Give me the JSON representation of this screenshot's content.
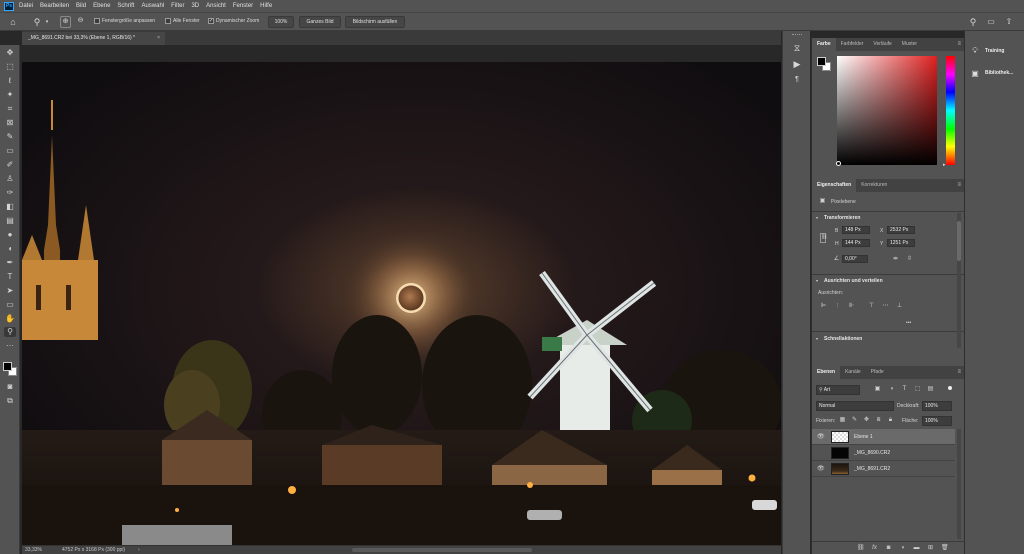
{
  "app": {
    "logo": "Ps"
  },
  "menu": [
    "Datei",
    "Bearbeiten",
    "Bild",
    "Ebene",
    "Schrift",
    "Auswahl",
    "Filter",
    "3D",
    "Ansicht",
    "Fenster",
    "Hilfe"
  ],
  "options": {
    "fit_windows_label": "Fenstergröße anpassen",
    "all_windows_label": "Alle Fenster",
    "scrubby_zoom_label": "Dynamischer Zoom",
    "zoom_percent_label": "100%",
    "fit_screen_label": "Ganzes Bild",
    "fill_screen_label": "Bildschirm ausfüllen",
    "checked": "✓"
  },
  "document": {
    "tab_title": "_MG_8691.CR2 bei 33,3% (Ebene 1, RGB/16) *",
    "close": "×",
    "zoom_status": "33,33%",
    "size_status": "4752 Px x 3168 Px (300 ppi)"
  },
  "color_panel": {
    "tabs": [
      "Farbe",
      "Farbfelder",
      "Verläufe",
      "Muster"
    ],
    "hue_color": "#e02020"
  },
  "properties_panel": {
    "tabs": [
      "Eigenschaften",
      "Korrekturen"
    ],
    "layer_type": "Pixelebene",
    "transform_title": "Transformieren",
    "w_label": "B",
    "w_value": "148 Px",
    "h_label": "H",
    "h_value": "144 Px",
    "x_label": "X",
    "x_value": "2532 Px",
    "y_label": "Y",
    "y_value": "1251 Px",
    "angle_value": "0,00°",
    "align_title": "Ausrichten und verteilen",
    "align_sub": "Ausrichten:",
    "more": "•••",
    "quick_title": "Schnellaktionen"
  },
  "layers_panel": {
    "tabs": [
      "Ebenen",
      "Kanäle",
      "Pfade"
    ],
    "filter_label": "Art",
    "blend_mode": "Normal",
    "opacity_label": "Deckkraft:",
    "opacity_value": "100%",
    "lock_label": "Fixieren:",
    "fill_label": "Fläche:",
    "fill_value": "100%",
    "layers": [
      {
        "name": "Ebene 1",
        "visible": true,
        "selected": true
      },
      {
        "name": "_MG_8690.CR2",
        "visible": false,
        "selected": false
      },
      {
        "name": "_MG_8691.CR2",
        "visible": true,
        "selected": false
      }
    ],
    "footer_icons": [
      "link-icon",
      "fx-icon",
      "mask-icon",
      "adjustment-icon",
      "folder-icon",
      "new-layer-icon",
      "trash-icon"
    ]
  },
  "dock": {
    "training_label": "Training",
    "libraries_label": "Bibliothek..."
  }
}
